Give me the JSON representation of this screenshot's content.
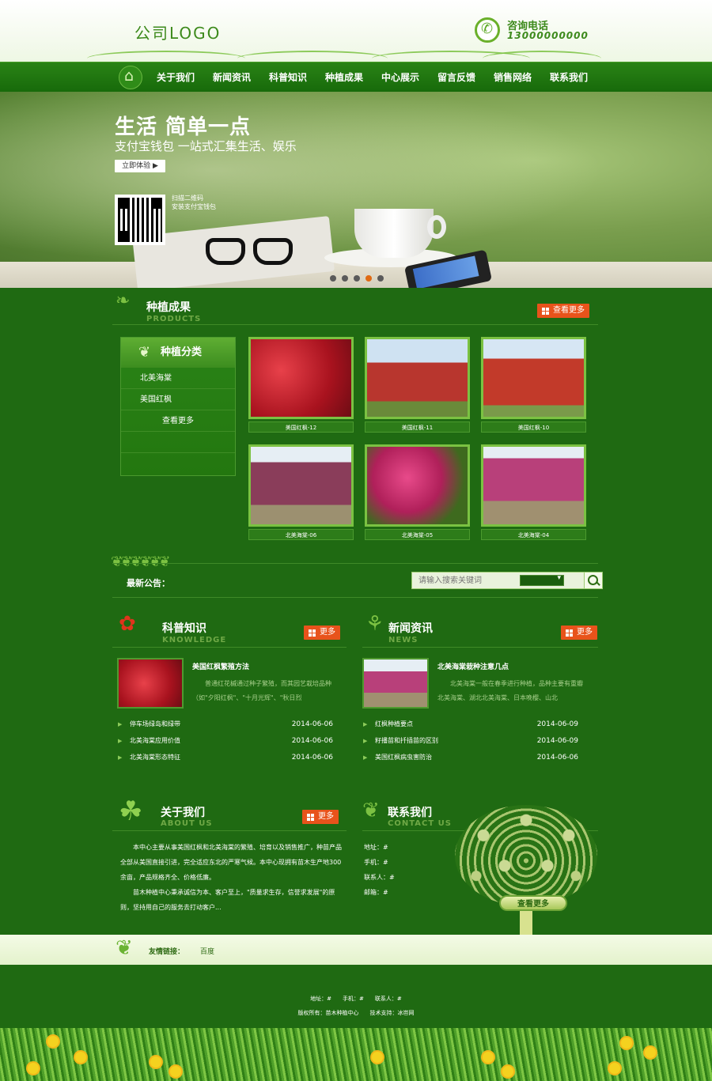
{
  "header": {
    "logo": "公司LOGO",
    "phone_label": "咨询电话",
    "phone_number": "13000000000"
  },
  "nav": {
    "items": [
      "关于我们",
      "新闻资讯",
      "科普知识",
      "种植成果",
      "中心展示",
      "留言反馈",
      "销售网络",
      "联系我们"
    ]
  },
  "banner": {
    "title": "生活 简单一点",
    "subtitle": "支付宝钱包 一站式汇集生活、娱乐",
    "button": "立即体验 ▶",
    "qr_line1": "扫描二维码",
    "qr_line2": "安装支付宝钱包",
    "active_slide": 4,
    "slide_count": 5
  },
  "products": {
    "title": "种植成果",
    "title_en": "PRODUCTS",
    "more": "查看更多",
    "category_title": "种植分类",
    "categories": [
      "北美海棠",
      "美国红枫"
    ],
    "category_more": "查看更多",
    "items": [
      {
        "caption": "美国红枫-12",
        "color": "#c8202b"
      },
      {
        "caption": "美国红枫-11",
        "color": "#b8362e"
      },
      {
        "caption": "美国红枫-10",
        "color": "#c23a2a"
      },
      {
        "caption": "北美海棠-06",
        "color": "#8a3d5a"
      },
      {
        "caption": "北美海棠-05",
        "color": "#c82a6a"
      },
      {
        "caption": "北美海棠-04",
        "color": "#b8407a"
      }
    ]
  },
  "notice": {
    "label": "最新公告：",
    "search_placeholder": "请输入搜索关键词"
  },
  "knowledge": {
    "title": "科普知识",
    "title_en": "KNOWLEDGE",
    "more": "更多",
    "feature_title": "美国红枫繁殖方法",
    "feature_text": "普通红花槭通过种子繁殖，而其园艺栽培品种（如\"夕阳红枫\"、\"十月光辉\"、\"秋日烈",
    "list": [
      {
        "title": "停车场绿岛和绿带",
        "date": "2014-06-06"
      },
      {
        "title": "北美海棠应用价值",
        "date": "2014-06-06"
      },
      {
        "title": "北美海棠形态特征",
        "date": "2014-06-06"
      }
    ]
  },
  "news": {
    "title": "新闻资讯",
    "title_en": "NEWS",
    "more": "更多",
    "feature_title": "北美海棠栽种注意几点",
    "feature_text": "北美海棠一般在春季进行种植，品种主要有重瓣北美海棠、湖北北美海棠、日本晚樱、山北",
    "list": [
      {
        "title": "红枫种植要点",
        "date": "2014-06-09"
      },
      {
        "title": "籽播苗和扦插苗的区别",
        "date": "2014-06-09"
      },
      {
        "title": "美国红枫病虫害防治",
        "date": "2014-06-06"
      }
    ]
  },
  "about": {
    "title": "关于我们",
    "title_en": "ABOUT US",
    "more": "更多",
    "para1": "本中心主要从事美国红枫和北美海棠的繁殖、培育以及销售推广，种苗产品全部从美国直接引进，完全适应东北的严寒气候。本中心现拥有苗木生产地300余亩，产品规格齐全、价格低廉。",
    "para2": "苗木种植中心秉承诚信为本、客户至上，\"质量求生存，信誉求发展\"的原则，坚持用自己的服务去打动客户..."
  },
  "contact": {
    "title": "联系我们",
    "title_en": "CONTACT US",
    "rows": [
      "地址：#",
      "手机：#",
      "联系人：#",
      "邮箱：#"
    ],
    "button": "查看更多"
  },
  "links": {
    "label": "友情链接：",
    "items": [
      "百度"
    ]
  },
  "footer": {
    "line1": "地址：#　　手机：#　　联系人：#",
    "line2": "版权所有：苗木种植中心　　技术支持：冰岜网"
  },
  "colors": {
    "page_bg": "#1f6a12",
    "accent_orange": "#e8531b",
    "leaf_green": "#7bc242"
  }
}
